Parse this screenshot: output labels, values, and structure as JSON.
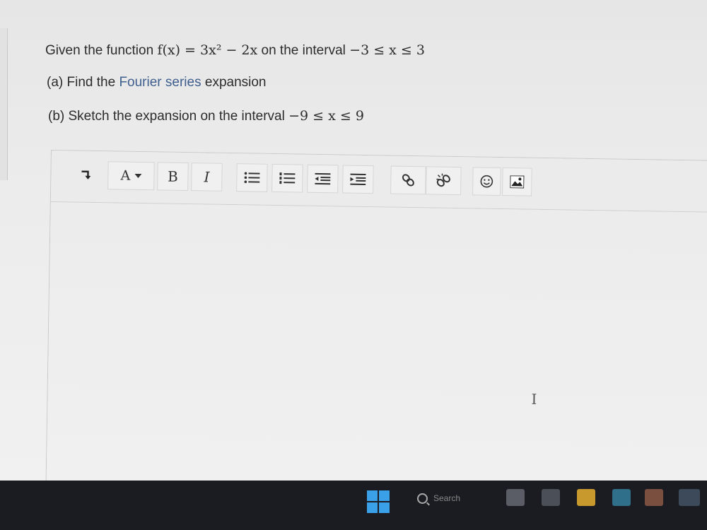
{
  "question": {
    "line1_prefix": "Given the function ",
    "line1_func": "f(x) = 3x² − 2x",
    "line1_mid": " on the interval ",
    "line1_interval": "−3 ≤ x ≤ 3",
    "part_a_prefix": "(a) Find the ",
    "part_a_link": "Fourier series",
    "part_a_suffix": " expansion",
    "part_b_prefix": "(b) Sketch the expansion on the interval ",
    "part_b_interval": "−9 ≤ x ≤ 9"
  },
  "toolbar": {
    "font_size_label": "A",
    "bold_label": "B",
    "italic_label": "I"
  },
  "editor": {
    "cursor_glyph": "I"
  },
  "taskbar": {
    "search_label": "Search"
  },
  "colors": {
    "link": "#3f5f8e",
    "taskbar": "#1b1c22",
    "windows_logo": "#3aa0e8"
  },
  "icons": {
    "paragraph": "paragraph-format-icon",
    "bulleted_list": "bulleted-list-icon",
    "numbered_list": "numbered-list-icon",
    "outdent": "outdent-icon",
    "indent": "indent-icon",
    "link": "link-icon",
    "unlink": "unlink-icon",
    "emoji": "emoji-icon",
    "image": "image-icon"
  }
}
